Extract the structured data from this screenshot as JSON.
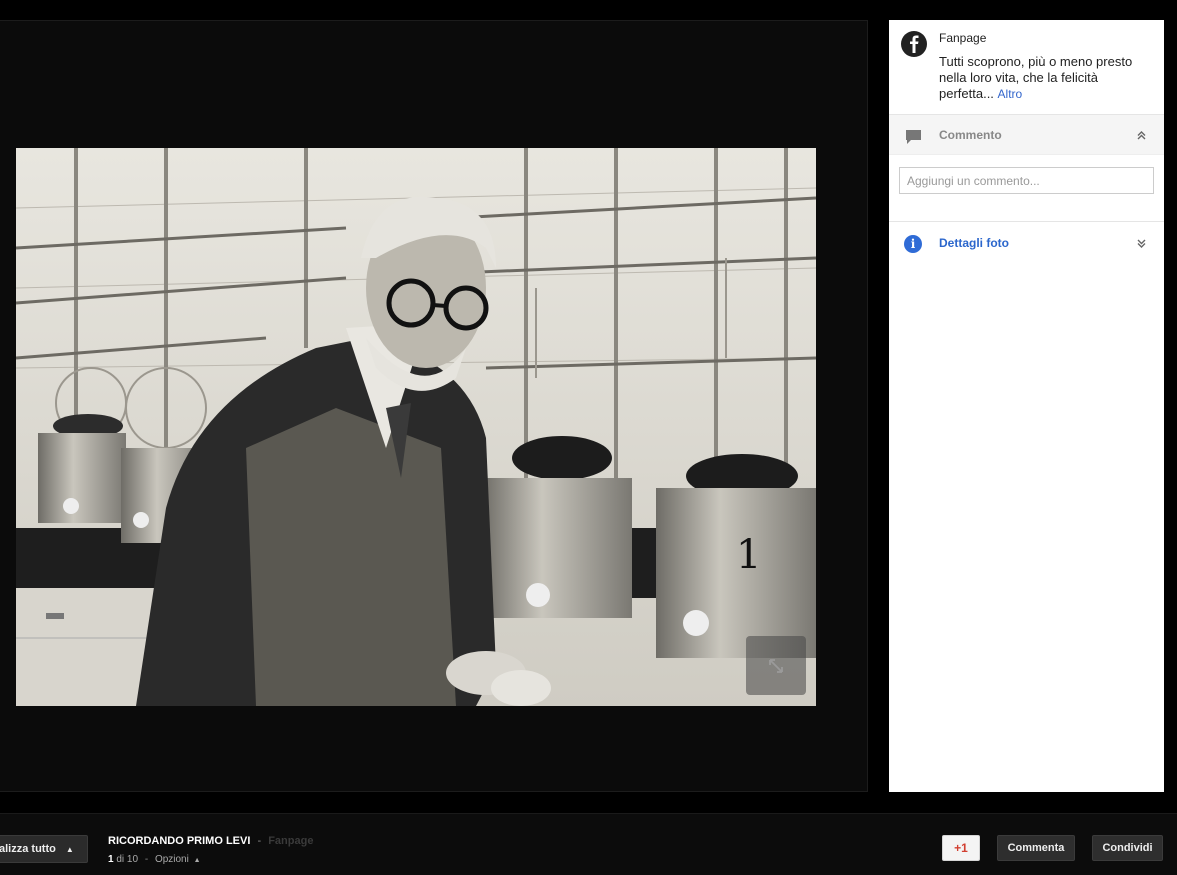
{
  "photo": {
    "alt": ""
  },
  "panel": {
    "author": "Fanpage",
    "post_text": "Tutti scoprono, più o meno presto nella loro vita, che la felicità perfetta...",
    "more_link": "Altro",
    "comment_section_title": "Commento",
    "comment_placeholder": "Aggiungi un commento...",
    "details_title": "Dettagli foto"
  },
  "bottom": {
    "view_all_label": "alizza tutto",
    "album_title": "RICORDANDO PRIMO LEVI",
    "title_separator": "-",
    "owner": "Fanpage",
    "current_index": "1",
    "of_total": "di 10",
    "options_label": "Opzioni",
    "plusone_label": "+1",
    "comment_label": "Commenta",
    "share_label": "Condividi"
  },
  "colors": {
    "accent_blue": "#2b66cc",
    "plusone_red": "#d23f31"
  },
  "icons": [
    "facebook-icon",
    "comment-icon",
    "collapse-chevron-icon",
    "info-icon",
    "expand-chevron-icon",
    "fullscreen-icon",
    "caret-up-icon"
  ]
}
